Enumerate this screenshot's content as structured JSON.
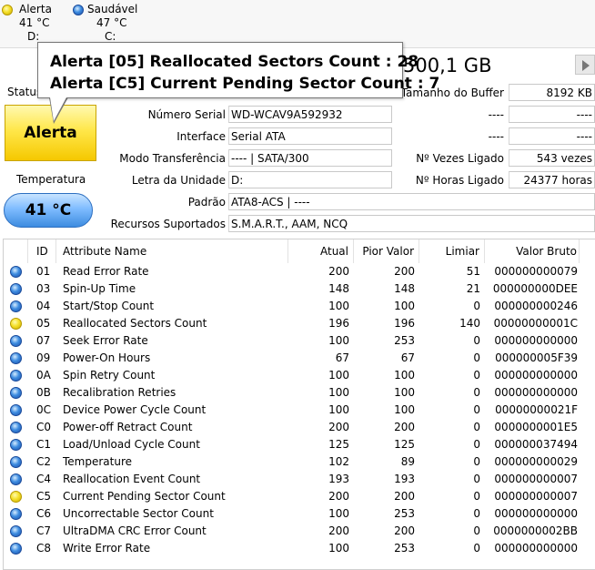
{
  "drives": [
    {
      "status": "Alerta",
      "temp": "41 °C",
      "letter": "D:",
      "color": "yellow"
    },
    {
      "status": "Saudável",
      "temp": "47 °C",
      "letter": "C:",
      "color": "blue"
    }
  ],
  "tooltip": {
    "line1": "Alerta [05] Reallocated Sectors Count : 28",
    "line2": "Alerta [C5] Current Pending Sector Count : 7"
  },
  "capacity": "500,1 GB",
  "status": {
    "label": "Status",
    "value": "Alerta",
    "color": "#f5c800"
  },
  "temperature": {
    "label": "Temperatura",
    "value": "41 °C",
    "color": "#3d8ce0"
  },
  "info": {
    "serial_label": "Número Serial",
    "serial": "WD-WCAV9A592932",
    "interface_label": "Interface",
    "interface": "Serial ATA",
    "transfer_label": "Modo Transferência",
    "transfer": "---- | SATA/300",
    "letter_label": "Letra da Unidade",
    "letter": "D:",
    "standard_label": "Padrão",
    "standard": "ATA8-ACS | ----",
    "features_label": "Recursos Suportados",
    "features": "S.M.A.R.T., AAM, NCQ",
    "buffer_label": "Tamanho do Buffer",
    "buffer": "8192 KB",
    "blank1_label": "----",
    "blank1": "----",
    "blank2_label": "----",
    "blank2": "----",
    "power_count_label": "Nº Vezes Ligado",
    "power_count": "543 vezes",
    "power_hours_label": "Nº Horas Ligado",
    "power_hours": "24377 horas"
  },
  "table": {
    "headers": [
      "ID",
      "Attribute Name",
      "Atual",
      "Pior Valor",
      "Limiar",
      "Valor Bruto"
    ],
    "rows": [
      {
        "status": "blue",
        "id": "01",
        "name": "Read Error Rate",
        "current": "200",
        "worst": "200",
        "threshold": "51",
        "raw": "000000000079"
      },
      {
        "status": "blue",
        "id": "03",
        "name": "Spin-Up Time",
        "current": "148",
        "worst": "148",
        "threshold": "21",
        "raw": "000000000DEE"
      },
      {
        "status": "blue",
        "id": "04",
        "name": "Start/Stop Count",
        "current": "100",
        "worst": "100",
        "threshold": "0",
        "raw": "000000000246"
      },
      {
        "status": "yellow",
        "id": "05",
        "name": "Reallocated Sectors Count",
        "current": "196",
        "worst": "196",
        "threshold": "140",
        "raw": "00000000001C"
      },
      {
        "status": "blue",
        "id": "07",
        "name": "Seek Error Rate",
        "current": "100",
        "worst": "253",
        "threshold": "0",
        "raw": "000000000000"
      },
      {
        "status": "blue",
        "id": "09",
        "name": "Power-On Hours",
        "current": "67",
        "worst": "67",
        "threshold": "0",
        "raw": "000000005F39"
      },
      {
        "status": "blue",
        "id": "0A",
        "name": "Spin Retry Count",
        "current": "100",
        "worst": "100",
        "threshold": "0",
        "raw": "000000000000"
      },
      {
        "status": "blue",
        "id": "0B",
        "name": "Recalibration Retries",
        "current": "100",
        "worst": "100",
        "threshold": "0",
        "raw": "000000000000"
      },
      {
        "status": "blue",
        "id": "0C",
        "name": "Device Power Cycle Count",
        "current": "100",
        "worst": "100",
        "threshold": "0",
        "raw": "00000000021F"
      },
      {
        "status": "blue",
        "id": "C0",
        "name": "Power-off Retract Count",
        "current": "200",
        "worst": "200",
        "threshold": "0",
        "raw": "0000000001E5"
      },
      {
        "status": "blue",
        "id": "C1",
        "name": "Load/Unload Cycle Count",
        "current": "125",
        "worst": "125",
        "threshold": "0",
        "raw": "000000037494"
      },
      {
        "status": "blue",
        "id": "C2",
        "name": "Temperature",
        "current": "102",
        "worst": "89",
        "threshold": "0",
        "raw": "000000000029"
      },
      {
        "status": "blue",
        "id": "C4",
        "name": "Reallocation Event Count",
        "current": "193",
        "worst": "193",
        "threshold": "0",
        "raw": "000000000007"
      },
      {
        "status": "yellow",
        "id": "C5",
        "name": "Current Pending Sector Count",
        "current": "200",
        "worst": "200",
        "threshold": "0",
        "raw": "000000000007"
      },
      {
        "status": "blue",
        "id": "C6",
        "name": "Uncorrectable Sector Count",
        "current": "100",
        "worst": "253",
        "threshold": "0",
        "raw": "000000000000"
      },
      {
        "status": "blue",
        "id": "C7",
        "name": "UltraDMA CRC Error Count",
        "current": "200",
        "worst": "200",
        "threshold": "0",
        "raw": "0000000002BB"
      },
      {
        "status": "blue",
        "id": "C8",
        "name": "Write Error Rate",
        "current": "100",
        "worst": "253",
        "threshold": "0",
        "raw": "000000000000"
      }
    ]
  }
}
